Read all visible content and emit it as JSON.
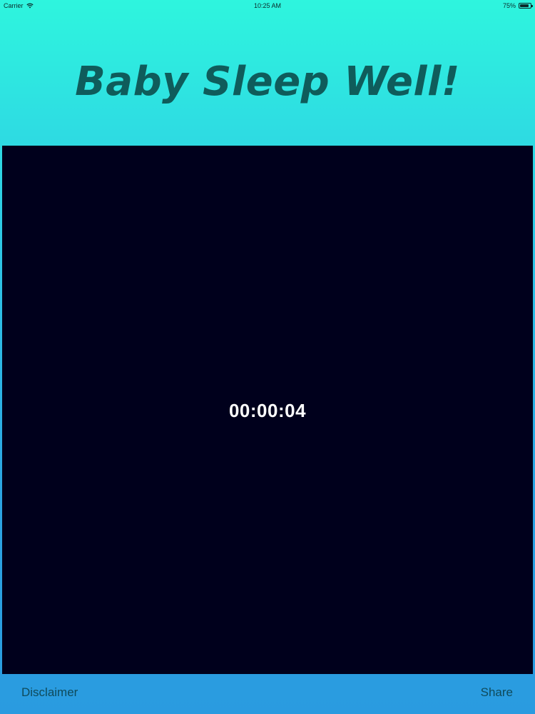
{
  "status_bar": {
    "carrier": "Carrier",
    "time": "10:25 AM",
    "battery": "75%"
  },
  "header": {
    "title": "Baby Sleep Well!"
  },
  "timer": {
    "value": "00:00:04"
  },
  "footer": {
    "disclaimer_label": "Disclaimer",
    "share_label": "Share"
  },
  "colors": {
    "header_gradient_top": "#2ef5de",
    "footer_blue": "#2a9be0",
    "panel_dark": "#00001c",
    "title_text": "#0f5c5b"
  }
}
